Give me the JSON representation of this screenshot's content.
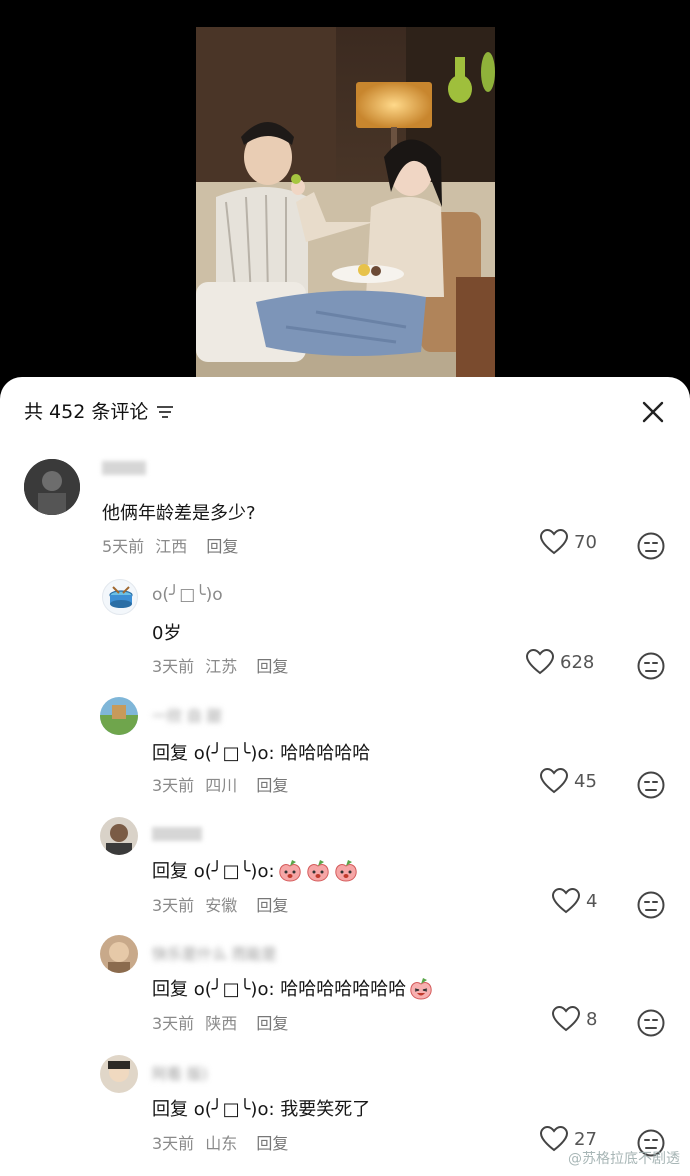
{
  "header": {
    "title": "共 452 条评论",
    "filter_icon": "filter-icon",
    "close_icon": "close-icon"
  },
  "comments": [
    {
      "username": "",
      "text": "他俩年龄差是多少?",
      "time": "5天前",
      "location": "江西",
      "reply_label": "回复",
      "likes": "70"
    },
    {
      "username": "o(╯□╰)o",
      "text": "0岁",
      "time": "3天前",
      "location": "江苏",
      "reply_label": "回复",
      "likes": "628"
    },
    {
      "username": "一欣 自 甜",
      "text": "回复 o(╯□╰)o: 哈哈哈哈哈",
      "time": "3天前",
      "location": "四川",
      "reply_label": "回复",
      "likes": "45"
    },
    {
      "username": "",
      "text": "回复 o(╯□╰)o:",
      "time": "3天前",
      "location": "安徽",
      "reply_label": "回复",
      "likes": "4"
    },
    {
      "username": "快乐是什么 而能是",
      "text": "回复 o(╯□╰)o: 哈哈哈哈哈哈哈",
      "time": "3天前",
      "location": "陕西",
      "reply_label": "回复",
      "likes": "8"
    },
    {
      "username": "阿看 版)",
      "text": "回复 o(╯□╰)o: 我要笑死了",
      "time": "3天前",
      "location": "山东",
      "reply_label": "回复",
      "likes": "27"
    }
  ],
  "watermark": "@苏格拉底不剧透",
  "colors": {
    "background": "#000000",
    "sheet": "#ffffff",
    "meta_text": "#8a8a8a",
    "body_text": "#161616"
  }
}
